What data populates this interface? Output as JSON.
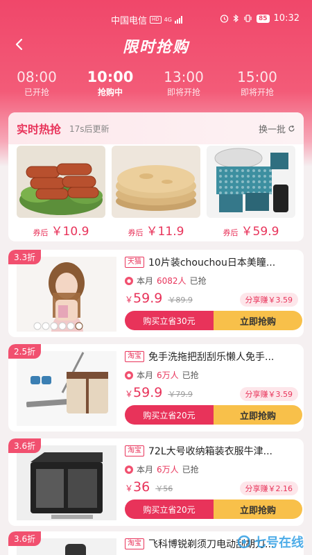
{
  "status": {
    "carrier": "中国电信",
    "hd": "HD",
    "net": "4G",
    "battery": "85",
    "time": "10:32"
  },
  "header": {
    "title": "限时抢购"
  },
  "tabs": [
    {
      "time": "08:00",
      "status": "已开抢"
    },
    {
      "time": "10:00",
      "status": "抢购中"
    },
    {
      "time": "13:00",
      "status": "即将开抢"
    },
    {
      "time": "15:00",
      "status": "即将开抢"
    }
  ],
  "hot": {
    "title": "实时热抢",
    "subtitle": "17s后更新",
    "refresh": "换一批",
    "items": [
      {
        "tag": "券后",
        "price": "￥10.9"
      },
      {
        "tag": "券后",
        "price": "￥11.9"
      },
      {
        "tag": "券后",
        "price": "￥59.9"
      }
    ]
  },
  "products": [
    {
      "discount": "3.3折",
      "platform": "天猫",
      "name": "10片装chouchou日本美瞳...",
      "sold_prefix": "本月",
      "sold_count": "6082人",
      "sold_suffix": "已抢",
      "price_sym": "￥",
      "price": "59.9",
      "old_price": "￥89.9",
      "share": "分享赚￥3.59",
      "save": "购买立省30元",
      "buy": "立即抢购"
    },
    {
      "discount": "2.5折",
      "platform": "淘宝",
      "name": "免手洗拖把刮刮乐懒人免手...",
      "sold_prefix": "本月",
      "sold_count": "6万人",
      "sold_suffix": "已抢",
      "price_sym": "￥",
      "price": "59.9",
      "old_price": "￥79.9",
      "share": "分享赚￥3.59",
      "save": "购买立省20元",
      "buy": "立即抢购"
    },
    {
      "discount": "3.6折",
      "platform": "淘宝",
      "name": "72L大号收纳箱装衣服牛津...",
      "sold_prefix": "本月",
      "sold_count": "6万人",
      "sold_suffix": "已抢",
      "price_sym": "￥",
      "price": "36",
      "old_price": "￥56",
      "share": "分享赚￥2.16",
      "save": "购买立省20元",
      "buy": "立即抢购"
    },
    {
      "discount": "3.6折",
      "platform": "淘宝",
      "name": "飞科博锐剃须刀电动刮胡刀..."
    }
  ],
  "watermark": "七号在线"
}
